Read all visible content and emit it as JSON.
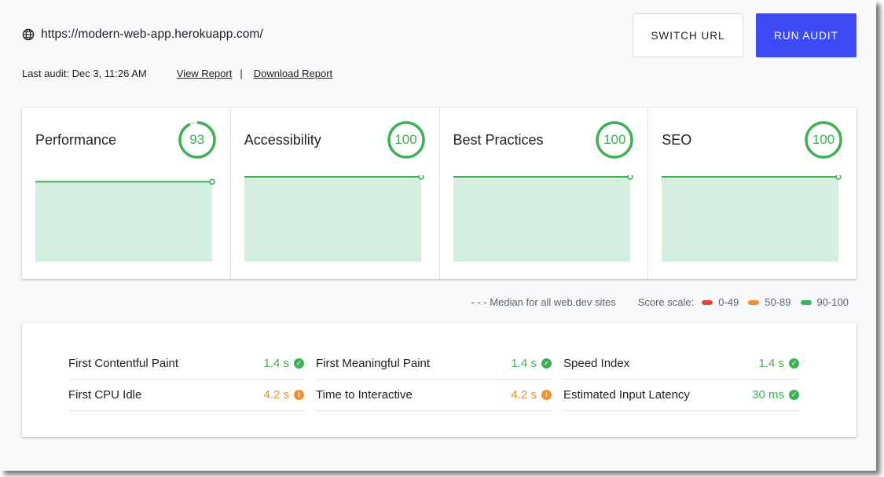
{
  "header": {
    "url": "https://modern-web-app.herokuapp.com/",
    "switch_label": "SWITCH URL",
    "run_label": "RUN AUDIT",
    "last_audit": "Last audit: Dec 3, 11:26 AM",
    "view_report": "View Report",
    "separator": "|",
    "download_report": "Download Report"
  },
  "colors": {
    "good": "#3fb055",
    "average": "#f0902e",
    "poor": "#e34a3d",
    "accent": "#3d4af5",
    "spark_fill": "#d4efdf"
  },
  "scores": [
    {
      "title": "Performance",
      "score": 93,
      "trend": [
        93,
        93
      ]
    },
    {
      "title": "Accessibility",
      "score": 100,
      "trend": [
        100,
        100
      ]
    },
    {
      "title": "Best Practices",
      "score": 100,
      "trend": [
        100,
        100
      ]
    },
    {
      "title": "SEO",
      "score": 100,
      "trend": [
        100,
        100
      ]
    }
  ],
  "legend": {
    "median": "- - - Median for all web.dev sites",
    "scale_label": "Score scale:",
    "items": [
      {
        "label": "0-49",
        "status": "poor"
      },
      {
        "label": "50-89",
        "status": "average"
      },
      {
        "label": "90-100",
        "status": "good"
      }
    ]
  },
  "metrics": [
    {
      "label": "First Contentful Paint",
      "value": "1.4 s",
      "status": "good",
      "icon": "check-icon"
    },
    {
      "label": "First Meaningful Paint",
      "value": "1.4 s",
      "status": "good",
      "icon": "check-icon"
    },
    {
      "label": "Speed Index",
      "value": "1.4 s",
      "status": "good",
      "icon": "check-icon"
    },
    {
      "label": "First CPU Idle",
      "value": "4.2 s",
      "status": "average",
      "icon": "info-icon"
    },
    {
      "label": "Time to Interactive",
      "value": "4.2 s",
      "status": "average",
      "icon": "info-icon"
    },
    {
      "label": "Estimated Input Latency",
      "value": "30 ms",
      "status": "good",
      "icon": "check-icon"
    }
  ]
}
